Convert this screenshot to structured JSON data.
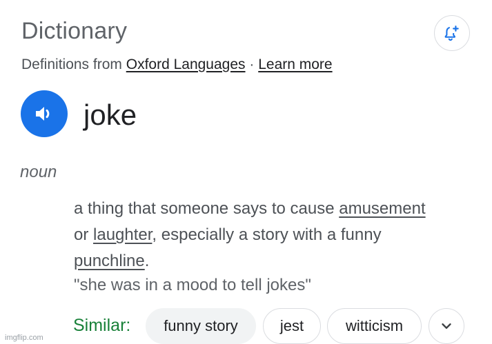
{
  "header": {
    "title": "Dictionary",
    "source_prefix": "Definitions from",
    "source_link": "Oxford Languages",
    "separator": "·",
    "learn_more": "Learn more",
    "alert_icon": "bell-plus-icon"
  },
  "entry": {
    "speaker_icon": "speaker-icon",
    "word": "joke",
    "part_of_speech": "noun",
    "definition": {
      "part1": "a thing that someone says to cause ",
      "link1": "amusement",
      "part2": " or ",
      "link2": "laughter",
      "part3": ", especially a story with a funny ",
      "link3": "punchline",
      "part4": "."
    },
    "example": "\"she was in a mood to tell jokes\""
  },
  "similar": {
    "label": "Similar:",
    "chips": [
      "funny story",
      "jest",
      "witticism"
    ],
    "more_icon": "chevron-down-icon"
  },
  "watermark": "imgflip.com",
  "colors": {
    "accent_blue": "#1a73e8",
    "similar_green": "#188038",
    "text_dark": "#202124",
    "text_grey": "#5f6368"
  }
}
